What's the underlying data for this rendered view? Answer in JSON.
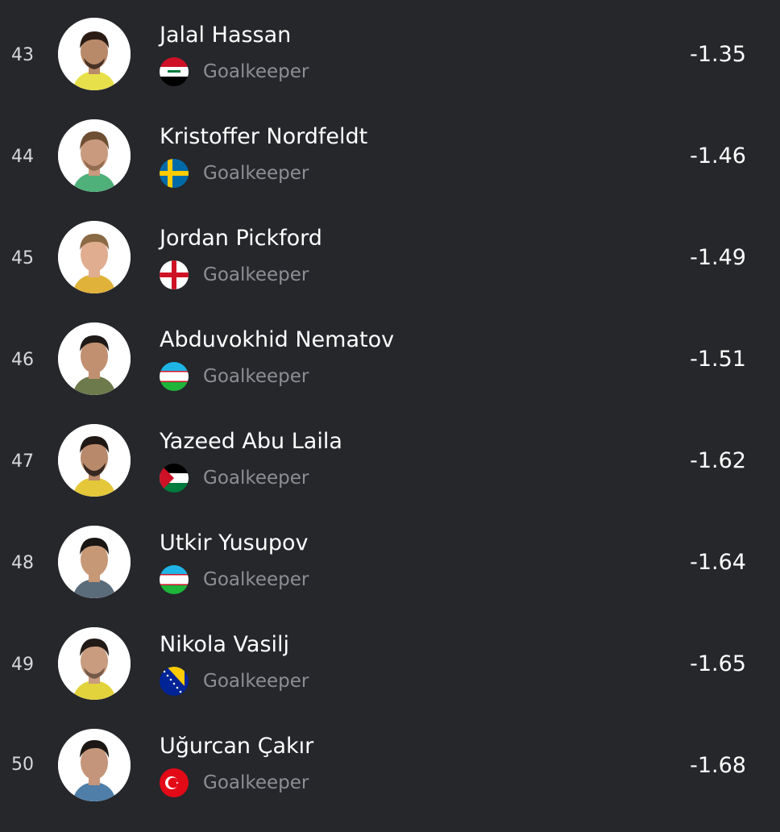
{
  "players": [
    {
      "rank": "43",
      "name": "Jalal Hassan",
      "position": "Goalkeeper",
      "value": "-1.35",
      "flag": "iraq-flag-icon",
      "kit": "#e8e04a",
      "skin": "#b98a6a",
      "hair": "#2a1c14"
    },
    {
      "rank": "44",
      "name": "Kristoffer Nordfeldt",
      "position": "Goalkeeper",
      "value": "-1.46",
      "flag": "sweden-flag-icon",
      "kit": "#4fb07a",
      "skin": "#c99a7e",
      "hair": "#6e4f33"
    },
    {
      "rank": "45",
      "name": "Jordan Pickford",
      "position": "Goalkeeper",
      "value": "-1.49",
      "flag": "england-flag-icon",
      "kit": "#e0b23a",
      "skin": "#e0ad90",
      "hair": "#8a6a44"
    },
    {
      "rank": "46",
      "name": "Abduvokhid Nematov",
      "position": "Goalkeeper",
      "value": "-1.51",
      "flag": "uzbekistan-flag-icon",
      "kit": "#6c7a4c",
      "skin": "#c09070",
      "hair": "#1e1a18"
    },
    {
      "rank": "47",
      "name": "Yazeed Abu Laila",
      "position": "Goalkeeper",
      "value": "-1.62",
      "flag": "jordan-flag-icon",
      "kit": "#e4c83a",
      "skin": "#b8896a",
      "hair": "#1f1814"
    },
    {
      "rank": "48",
      "name": "Utkir Yusupov",
      "position": "Goalkeeper",
      "value": "-1.64",
      "flag": "uzbekistan-flag-icon",
      "kit": "#5a6b7a",
      "skin": "#c79876",
      "hair": "#1a1614"
    },
    {
      "rank": "49",
      "name": "Nikola Vasilj",
      "position": "Goalkeeper",
      "value": "-1.65",
      "flag": "bosnia-flag-icon",
      "kit": "#e2d23c",
      "skin": "#c99b7f",
      "hair": "#221a16"
    },
    {
      "rank": "50",
      "name": "Uğurcan Çakır",
      "position": "Goalkeeper",
      "value": "-1.68",
      "flag": "turkey-flag-icon",
      "kit": "#4f7fa8",
      "skin": "#c4957a",
      "hair": "#1c1714"
    }
  ]
}
